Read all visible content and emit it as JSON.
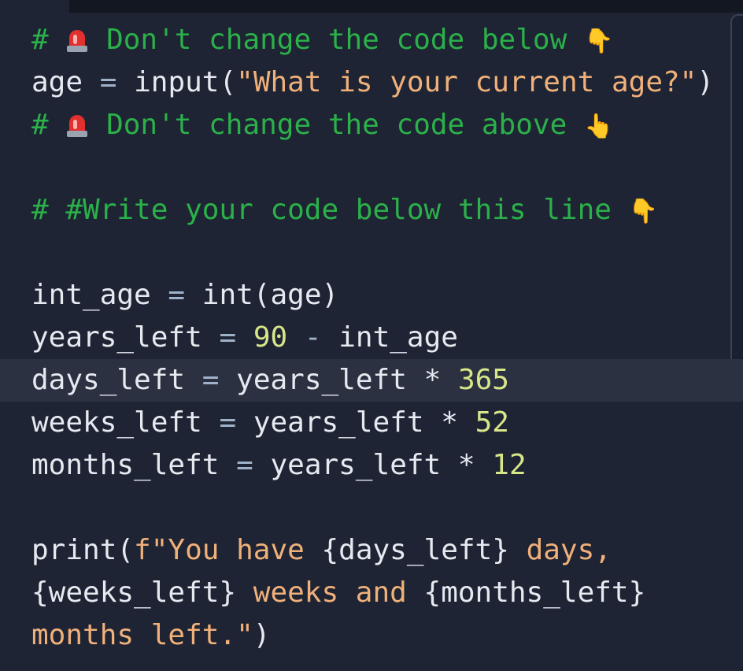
{
  "editor": {
    "lines": [
      {
        "hash": "#",
        "comment": "Don't change the code below",
        "hand": "👇"
      },
      {
        "var": "age",
        "eq": "=",
        "fn": "input(",
        "str": "\"What is your current age?\"",
        "close": ")"
      },
      {
        "hash": "#",
        "comment": "Don't change the code above",
        "hand": "👆"
      },
      {
        "blank": ""
      },
      {
        "comment": "# #Write your code below this line",
        "hand": "👇"
      },
      {
        "blank": ""
      },
      {
        "var": "int_age",
        "eq": "=",
        "rest": "int(age)"
      },
      {
        "var": "years_left",
        "eq": "=",
        "num": "90",
        "op": "-",
        "rest": "int_age"
      },
      {
        "var": "days_left",
        "eq": "=",
        "rest": "years_left",
        "op": "*",
        "num": "365"
      },
      {
        "var": "weeks_left",
        "eq": "=",
        "rest": "years_left",
        "op": "*",
        "num": "52"
      },
      {
        "var": "months_left",
        "eq": "=",
        "rest": "years_left",
        "op": "*",
        "num": "12"
      },
      {
        "blank": ""
      },
      {
        "fn": "print(",
        "fprefix": "f\"",
        "s1": "You have ",
        "b1": "{days_left}",
        "s2": " days,"
      },
      {
        "b2": "{weeks_left}",
        "s3": " weeks and ",
        "b3": "{months_left}"
      },
      {
        "s4": "months left.\"",
        "close": ")"
      }
    ],
    "icons": {
      "siren": "siren-emoji-icon",
      "hand_down": "backhand-index-pointing-down-icon",
      "hand_up": "backhand-index-pointing-up-icon"
    },
    "colors": {
      "background": "#1e2433",
      "comment": "#2bb04a",
      "string": "#f0b07a",
      "number": "#d8e68a",
      "active_line": "#2b3140"
    }
  }
}
